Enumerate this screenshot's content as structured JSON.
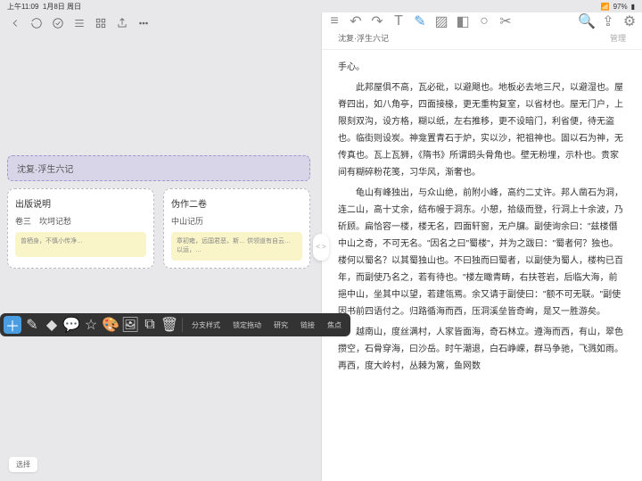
{
  "status": {
    "time": "上午11:09",
    "date": "1月8日 周日",
    "battery": "97%"
  },
  "doc": {
    "title": "沈复·浮生六记",
    "manage": "管理",
    "p0": "手心。",
    "p1": "此邦屋俱不高，瓦必砒，以避飓也。地板必去地三尺，以避湿也。屋脊四出，如八角亭，四面接椽，更无重构复室，以省材也。屋无门户，上限刻双沟，设方格，糊以纸，左右推移，更不设暗门，利省便，待无盗也。临街则设炭。神龛置青石于炉，实以沙，祀祖神也。固以石为神，无传真也。瓦上瓦狮，《隋书》所谓鸱头骨角也。壁无粉埋，示朴也。贵家间有糊碎粉花笺，习华风，渐奢也。",
    "p2": "龟山有峰独出，与众山绝，前附小峰，高约二丈许。邦人凿石为洞，连二山，高十丈余，结布幔于洞东。小憩，拾级而登，行洞上十余波，乃斫顾。扁恰容一楼，楼无名，四面轩窗，无户牖。副使询余曰：\"兹楼僭中山之奇，不可无名。\"因名之曰\"蜀楼\"，并为之跋曰：\"蜀者何？独也。楼何以蜀名？以其蜀独山也。不曰独而曰蜀者，以副使为蜀人，楼构已百年，而副使乃名之，若有待也。\"楼左瞰青畴，右扶苍岩，后临大海，前挹中山，坐其中以望，若建瓴焉。余又请于副使曰：\"额不可无联。\"副使因书前四语付之。归路循海而西，压洞溪垒皆奇峋，是又一胜游矣。",
    "p3": "越南山，度丝满村，人家皆面海，奇石林立。遵海而西，有山，翠色攒空，石骨穿海，曰沙岳。时午潮退，白石峥嵘，群马争驰，飞溅如雨。再西，度大岭村，丛棘为篱，鱼网数"
  },
  "map": {
    "root": "沈复·浮生六记",
    "card1": {
      "title": "出版说明",
      "sub": "卷三　坎坷记愁",
      "note": "曾栖身，不慎小传净…"
    },
    "card2": {
      "title": "伪作二卷",
      "sub": "中山记历",
      "note": "章初雍，远国君恶，斯…\n供领道有自云…\n以运，…"
    }
  },
  "toolbar": {
    "t1": "分支样式",
    "t2": "锁定拖动",
    "t3": "研究",
    "t4": "链接",
    "t5": "焦点"
  },
  "select": "选择"
}
